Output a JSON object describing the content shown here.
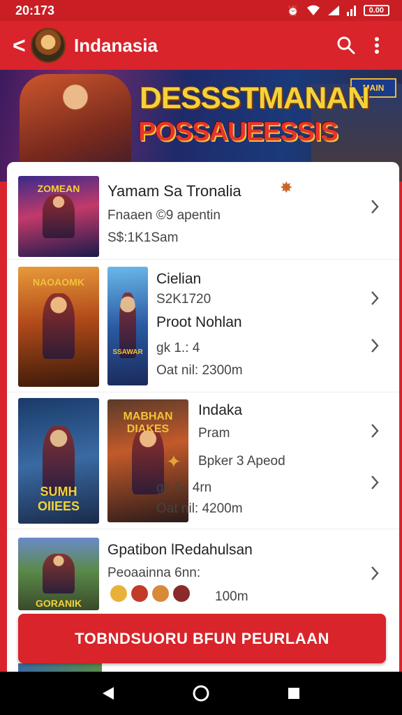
{
  "status_bar": {
    "time": "20:173",
    "battery": "0.00"
  },
  "app_bar": {
    "back_glyph": "<",
    "title": "Indanasia"
  },
  "banner": {
    "title": "DESSSTMANAN",
    "subtitle": "POSSAUEESSIS",
    "sign": "MAIN"
  },
  "list": [
    {
      "thumbs": [
        {
          "caption": "ZOMEAN"
        }
      ],
      "title": "Yamam Sa Tronalia",
      "line1": "Fnaaen ©9 apentin",
      "line2": "S$:1K1Sam"
    },
    {
      "thumbs": [
        {
          "caption": "NAOAOMK"
        },
        {
          "caption": "SSAWAR"
        }
      ],
      "title": "Cielian",
      "line1": "S2K1720",
      "line2": "Proot Nohlan",
      "line3": "gk 1.: 4",
      "line4": "Oat nil: 2300m"
    },
    {
      "thumbs": [
        {
          "caption": "SUMH OIIEES"
        },
        {
          "caption": "MABHAN DIAKES"
        }
      ],
      "title": "Indaka",
      "line1": "Pram",
      "line2": "Bpker 3 Apeod",
      "line3": "gk 1.: 4rn",
      "line4": "Oat nil: 4200m"
    },
    {
      "thumbs": [
        {
          "caption": "GORANIK"
        }
      ],
      "title": "Gpatibon lRedahulsan",
      "line1": "Peoaainna 6nn:",
      "line2": "100m"
    }
  ],
  "cta": {
    "label": "TOBNDSUORU BFUN PEURLAAN"
  }
}
